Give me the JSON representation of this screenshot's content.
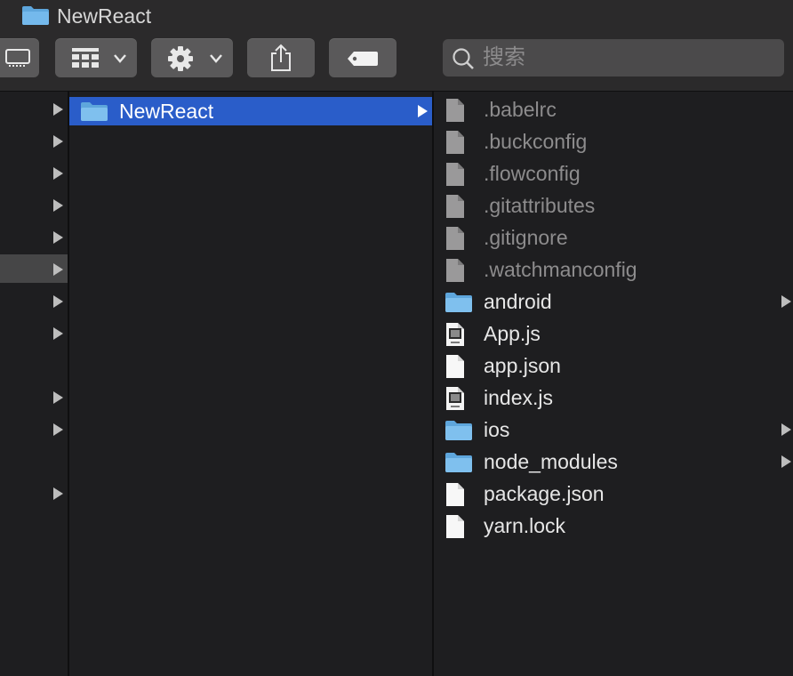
{
  "window": {
    "title": "NewReact"
  },
  "toolbar": {
    "search_placeholder": "搜索"
  },
  "icons": {
    "title": "folder-icon",
    "view": "column-view-icon",
    "group": "grid-icon",
    "action": "gear-icon",
    "share": "share-icon",
    "tags": "tag-icon",
    "search": "search-icon"
  },
  "colors": {
    "selection": "#2a5dc9",
    "folder": "#6fb5e8",
    "hidden_text": "#8d8c8d"
  },
  "col2": {
    "selected": "NewReact"
  },
  "col3": {
    "items": [
      {
        "name": ".babelrc",
        "kind": "hidden"
      },
      {
        "name": ".buckconfig",
        "kind": "hidden"
      },
      {
        "name": ".flowconfig",
        "kind": "hidden"
      },
      {
        "name": ".gitattributes",
        "kind": "hidden"
      },
      {
        "name": ".gitignore",
        "kind": "hidden"
      },
      {
        "name": ".watchmanconfig",
        "kind": "hidden"
      },
      {
        "name": "android",
        "kind": "folder"
      },
      {
        "name": "App.js",
        "kind": "js"
      },
      {
        "name": "app.json",
        "kind": "doc"
      },
      {
        "name": "index.js",
        "kind": "js"
      },
      {
        "name": "ios",
        "kind": "folder"
      },
      {
        "name": "node_modules",
        "kind": "folder"
      },
      {
        "name": "package.json",
        "kind": "doc"
      },
      {
        "name": "yarn.lock",
        "kind": "doc"
      }
    ]
  }
}
